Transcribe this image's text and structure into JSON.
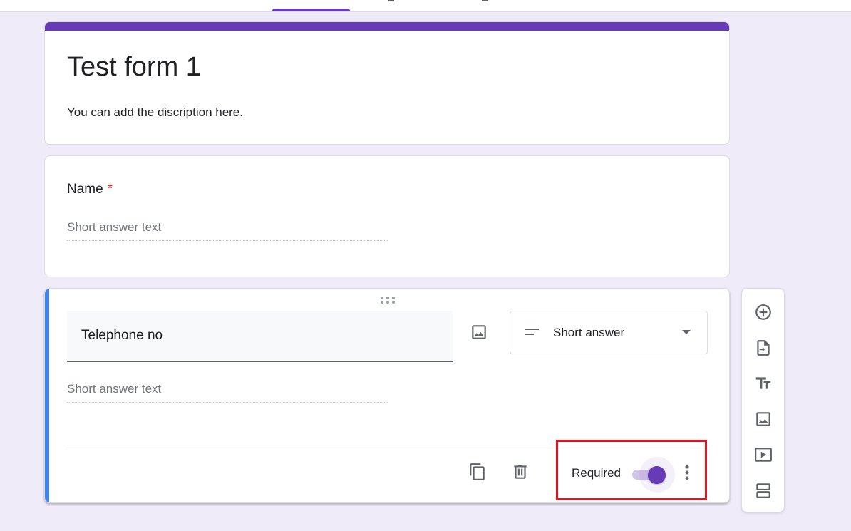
{
  "form": {
    "title": "Test form 1",
    "description": "You can add the discription here."
  },
  "questions": [
    {
      "title": "Name",
      "required_marker": "*",
      "answer_placeholder": "Short answer text"
    },
    {
      "title": "Telephone no",
      "answer_placeholder": "Short answer text",
      "type": "Short answer",
      "required_label": "Required",
      "required": true
    }
  ],
  "icons": {
    "question_image": "image-icon",
    "type_short_answer": "short-text-icon",
    "type_dropdown": "arrow-drop-down-icon",
    "duplicate": "copy-icon",
    "delete": "trash-icon",
    "more": "more-vert-icon",
    "drag": "drag-handle-icon"
  },
  "side_toolbar": [
    {
      "icon": "add-circle-icon"
    },
    {
      "icon": "import-questions-icon"
    },
    {
      "icon": "title-text-icon"
    },
    {
      "icon": "image-icon"
    },
    {
      "icon": "video-icon"
    },
    {
      "icon": "section-icon"
    }
  ],
  "colors": {
    "accent": "#673ab7",
    "page_background": "#f0ebf8",
    "active_question_border": "#4285f4",
    "required_asterisk": "#d93025",
    "annotation_box": "#e0131f"
  }
}
